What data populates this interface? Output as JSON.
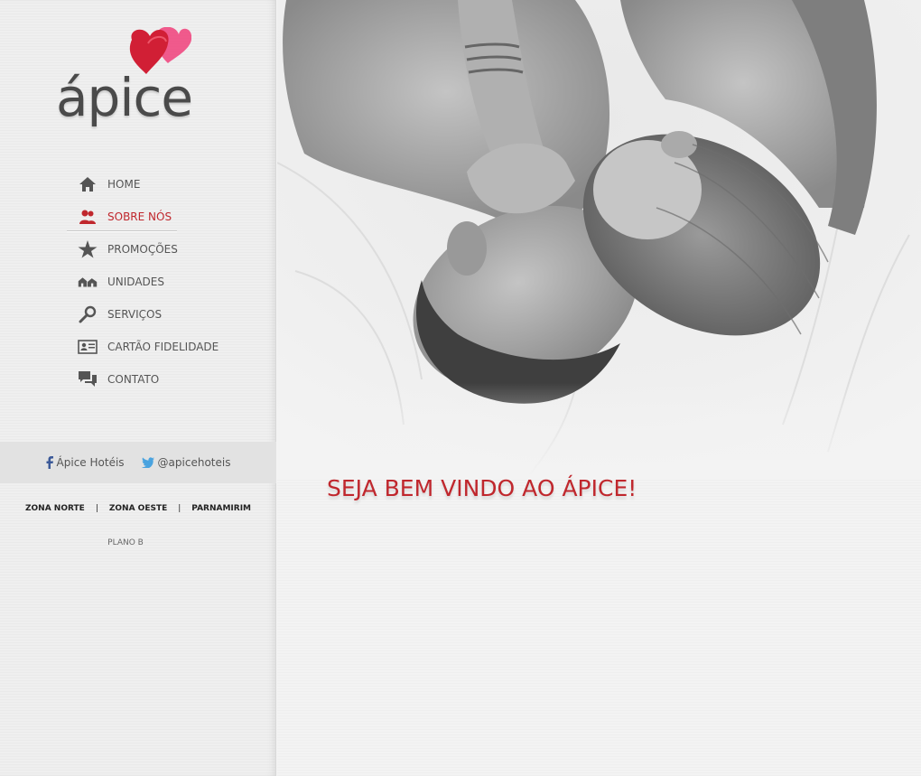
{
  "brand": {
    "name": "ápice"
  },
  "nav": {
    "items": [
      {
        "label": "HOME",
        "icon": "home-icon"
      },
      {
        "label": "SOBRE NÓS",
        "icon": "users-icon",
        "active": true
      },
      {
        "label": "PROMOÇÕES",
        "icon": "star-icon"
      },
      {
        "label": "UNIDADES",
        "icon": "buildings-icon"
      },
      {
        "label": "SERVIÇOS",
        "icon": "magnifier-icon"
      },
      {
        "label": "CARTÃO FIDELIDADE",
        "icon": "id-card-icon"
      },
      {
        "label": "CONTATO",
        "icon": "chat-icon"
      }
    ]
  },
  "social": {
    "facebook": "Ápice Hotéis",
    "twitter": "@apicehoteis"
  },
  "zones": {
    "items": [
      "ZONA NORTE",
      "ZONA OESTE",
      "PARNAMIRIM"
    ],
    "separator": "|",
    "extra": "PLANO B"
  },
  "main": {
    "welcome": "SEJA BEM VINDO AO ÁPICE!"
  },
  "colors": {
    "accent": "#c0272d",
    "heart_dark": "#d11f35",
    "heart_light": "#f0407a"
  }
}
